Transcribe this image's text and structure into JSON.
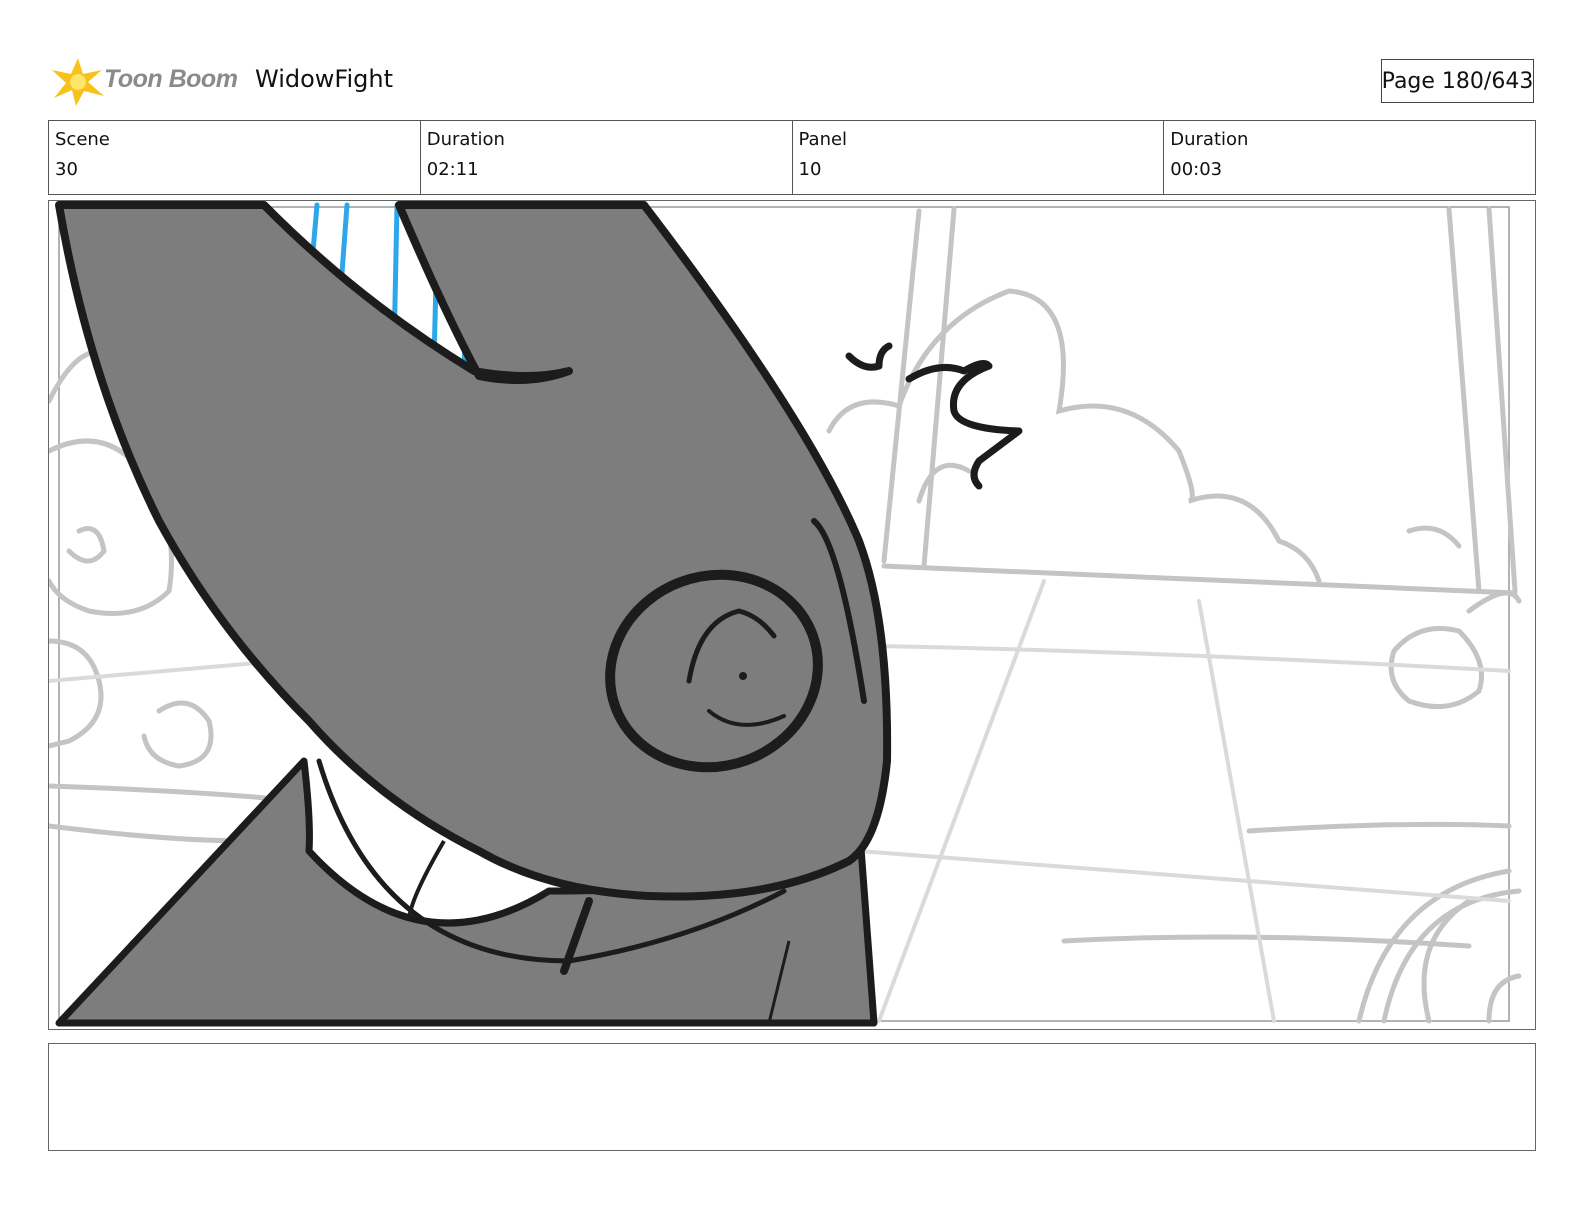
{
  "header": {
    "logo_text": "Toon Boom",
    "project_title": "WidowFight",
    "page_indicator": "Page 180/643"
  },
  "info": [
    {
      "label": "Scene",
      "value": "30"
    },
    {
      "label": "Duration",
      "value": "02:11"
    },
    {
      "label": "Panel",
      "value": "10"
    },
    {
      "label": "Duration",
      "value": "00:03"
    }
  ],
  "notes": {
    "text": ""
  },
  "colors": {
    "logo_star": "#f7c21a",
    "character_fill": "#7d7d7d",
    "speed_lines": "#2da6ea",
    "background_lines": "#c4c4c4"
  }
}
